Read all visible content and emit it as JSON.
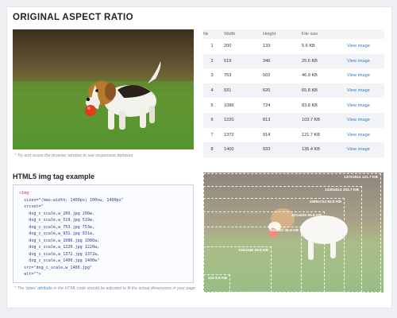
{
  "section1": {
    "title": "ORIGINAL ASPECT RATIO",
    "note": "* Try and resize the browser window to see responsive behavior"
  },
  "table": {
    "headers": [
      "№",
      "Width",
      "Height",
      "File size",
      ""
    ],
    "rows": [
      {
        "n": "1",
        "w": "200",
        "h": "133",
        "size": "5.6 KB",
        "link": "View image"
      },
      {
        "n": "2",
        "w": "519",
        "h": "346",
        "size": "25.6 KB",
        "link": "View image"
      },
      {
        "n": "3",
        "w": "753",
        "h": "502",
        "size": "46.9 KB",
        "link": "View image"
      },
      {
        "n": "4",
        "w": "931",
        "h": "620",
        "size": "65.8 KB",
        "link": "View image"
      },
      {
        "n": "5",
        "w": "1086",
        "h": "724",
        "size": "83.8 KB",
        "link": "View image"
      },
      {
        "n": "6",
        "w": "1220",
        "h": "813",
        "size": "103.7 KB",
        "link": "View image"
      },
      {
        "n": "7",
        "w": "1372",
        "h": "914",
        "size": "121.7 KB",
        "link": "View image"
      },
      {
        "n": "8",
        "w": "1400",
        "h": "933",
        "size": "135.4 KB",
        "link": "View image"
      }
    ]
  },
  "section2": {
    "title": "HTML5 img tag example",
    "code": {
      "open": "<img",
      "sizes": "  sizes=\"(max-width: 1400px) 100vw, 1400px\"",
      "srcset_open": "  srcset=\"",
      "srcset": [
        "    dog_c_scale,w_200.jpg 200w,",
        "    dog_c_scale,w_519.jpg 519w,",
        "    dog_c_scale,w_753.jpg 753w,",
        "    dog_c_scale,w_931.jpg 931w,",
        "    dog_c_scale,w_1086.jpg 1086w,",
        "    dog_c_scale,w_1220.jpg 1220w,",
        "    dog_c_scale,w_1372.jpg 1372w,",
        "    dog_c_scale,w_1400.jpg 1400w\""
      ],
      "src": "  src=\"dog_c_scale,w_1400.jpg\"",
      "alt": "  alt=\"\">"
    },
    "note_before": "* The ",
    "note_attr": "'sizes' attribute",
    "note_after": " in the HTML code should be adjusted to fit the actual dimensions in your page"
  },
  "breakpoints": [
    {
      "label": "1372x914 121.7 KB",
      "width": 1372
    },
    {
      "label": "1220x813 103.7 KB",
      "width": 1220
    },
    {
      "label": "1086x724 83.8 KB",
      "width": 1086
    },
    {
      "label": "931x620 65.8 KB",
      "width": 931
    },
    {
      "label": "753x502 46.9 KB",
      "width": 753
    },
    {
      "label": "519x346 25.6 KB",
      "width": 519
    },
    {
      "label": "133 5.6 KB",
      "width": 200
    }
  ],
  "colors": {
    "link": "#2f7cc6",
    "code_tag": "#c0328a",
    "grass": "#4c8f2c"
  }
}
